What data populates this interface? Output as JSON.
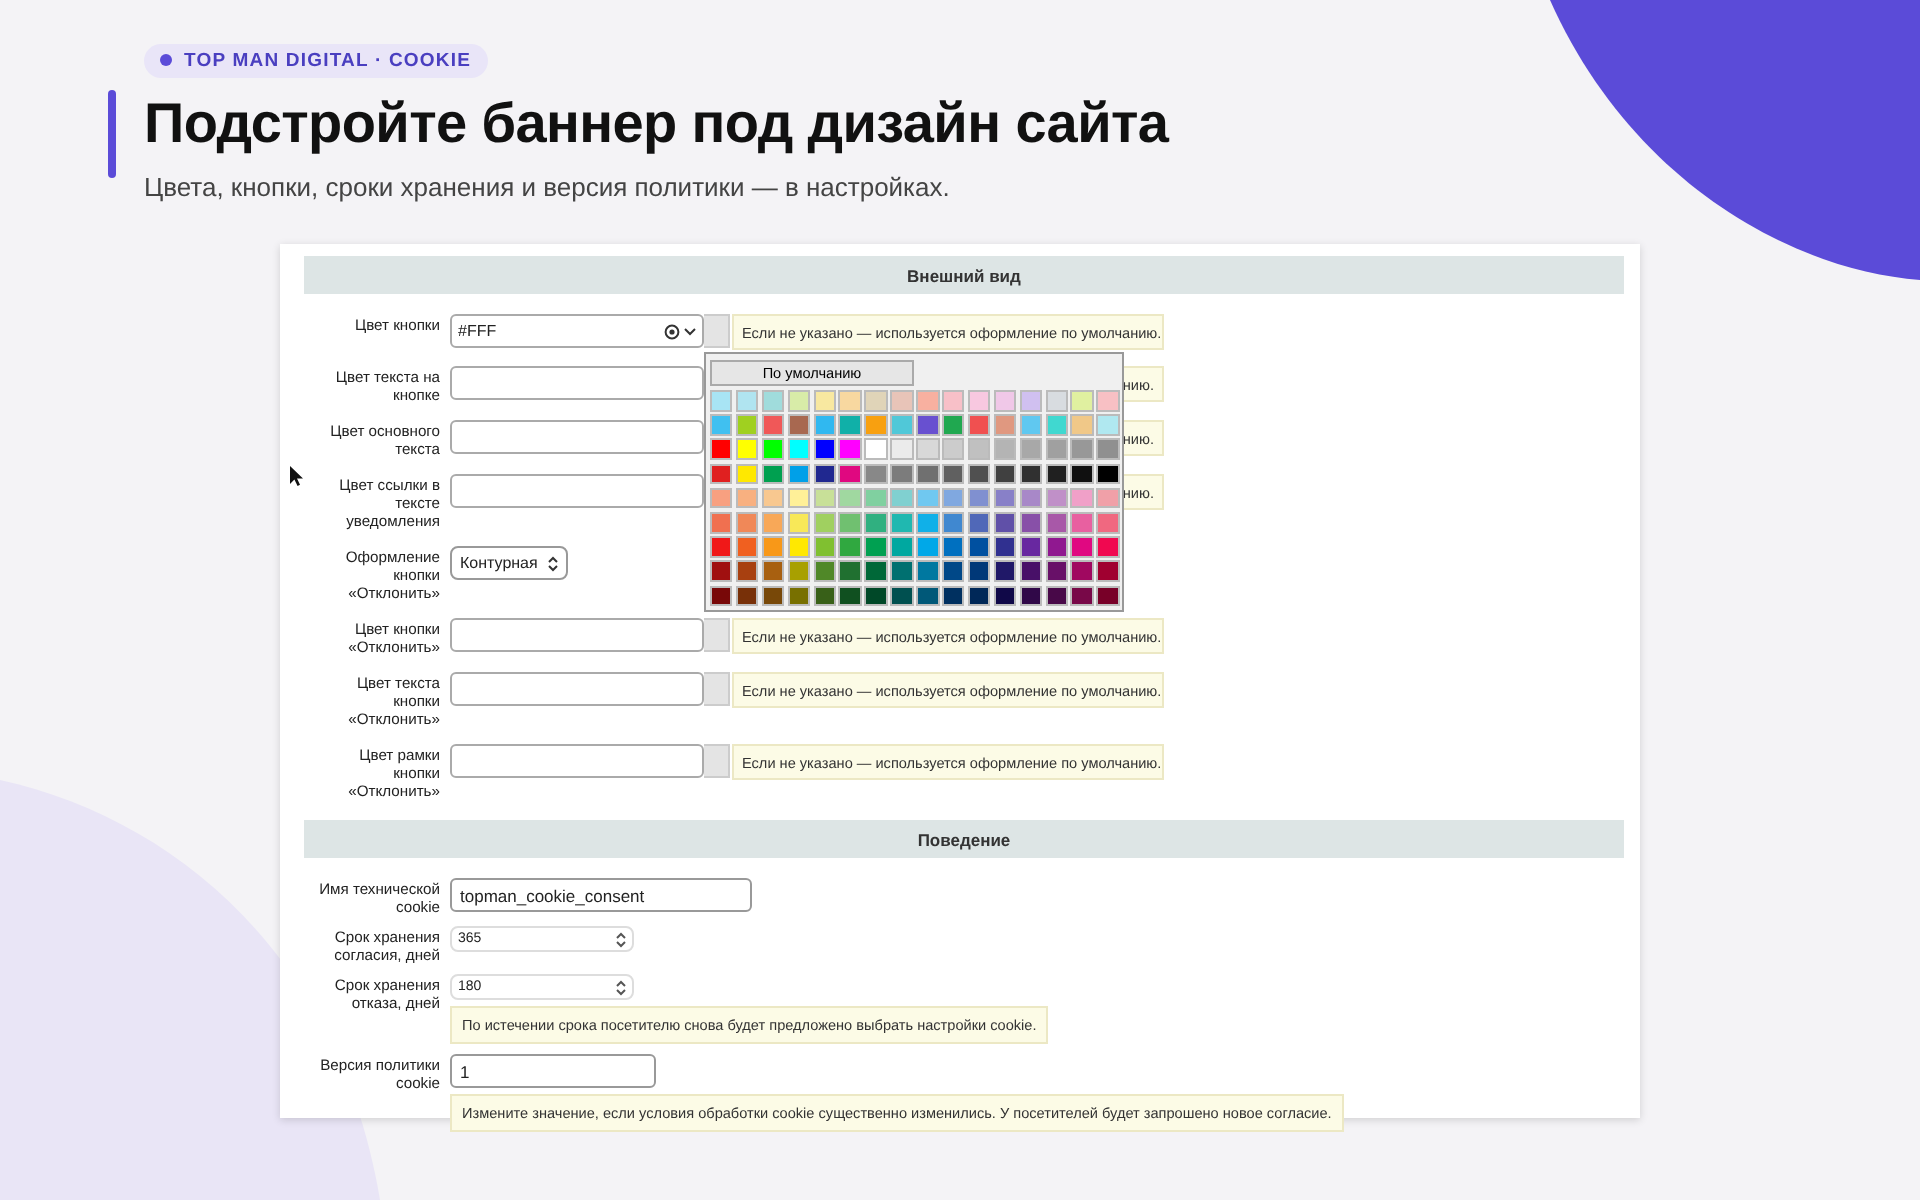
{
  "badge": "TOP MAN DIGITAL · COOKIE",
  "title": "Подстройте баннер под дизайн сайта",
  "subtitle": "Цвета, кнопки, сроки хранения и версия политики — в настройках.",
  "appearance": {
    "heading": "Внешний вид",
    "rows": [
      {
        "kind": "color",
        "label": "Цвет кнопки",
        "value": "#FFF",
        "hint": "Если не указано — используется оформление по умолчанию.",
        "hint_partial": false,
        "color_picker": {
          "default_button": "По умолчанию",
          "palette": [
            [
              {
                "color": "#a8e4f4"
              },
              {
                "color": "#b0e4f0"
              },
              {
                "color": "#a0dcdc"
              },
              {
                "color": "#d8eca8"
              },
              {
                "color": "#f8e8a0"
              },
              {
                "color": "#f8d8a0"
              },
              {
                "color": "#e0d4b8"
              },
              {
                "color": "#e8c4b8"
              },
              {
                "color": "#f8b0a0"
              },
              {
                "color": "#f8c0c8"
              },
              {
                "color": "#f8c8e0"
              },
              {
                "color": "#f0c8e8"
              },
              {
                "color": "#d0c0f0"
              },
              {
                "color": "#d8dce0"
              },
              {
                "color": "#e0f0a0"
              },
              {
                "color": "#f8c0c4"
              }
            ],
            [
              {
                "color": "#40c0f0"
              },
              {
                "color": "#a0d020"
              },
              {
                "color": "#f05858"
              },
              {
                "color": "#a86850"
              },
              {
                "color": "#30b8f0"
              },
              {
                "color": "#10b0a8"
              },
              {
                "color": "#f8a010"
              },
              {
                "color": "#50c8d8"
              },
              {
                "color": "#6850d0"
              },
              {
                "color": "#20a850"
              },
              {
                "color": "#f05050"
              },
              {
                "color": "#e09880"
              },
              {
                "color": "#60c8f0"
              },
              {
                "color": "#40d8d0"
              },
              {
                "color": "#f0c888"
              },
              {
                "color": "#b0e8f0"
              }
            ],
            [
              {
                "color": "#ff0000"
              },
              {
                "color": "#ffff00"
              },
              {
                "color": "#00ff00"
              },
              {
                "color": "#00ffff"
              },
              {
                "color": "#0000ff"
              },
              {
                "color": "#ff00ff"
              },
              {
                "color": "#ffffff"
              },
              {
                "color": "#ebebeb"
              },
              {
                "color": "#d8d8d8"
              },
              {
                "color": "#cccccc"
              },
              {
                "color": "#c0c0c0"
              },
              {
                "color": "#b4b4b4"
              },
              {
                "color": "#a8a8a8"
              },
              {
                "color": "#a0a0a0"
              },
              {
                "color": "#989898"
              },
              {
                "color": "#909090"
              }
            ],
            [
              {
                "color": "#e02020"
              },
              {
                "color": "#ffe800"
              },
              {
                "color": "#00a050"
              },
              {
                "color": "#00a0e8"
              },
              {
                "color": "#202890"
              },
              {
                "color": "#e00880"
              },
              {
                "color": "#888888"
              },
              {
                "color": "#7c7c7c"
              },
              {
                "color": "#707070"
              },
              {
                "color": "#606060"
              },
              {
                "color": "#505050"
              },
              {
                "color": "#404040"
              },
              {
                "color": "#303030"
              },
              {
                "color": "#202020"
              },
              {
                "color": "#101010"
              },
              {
                "color": "#000000"
              }
            ],
            [
              {
                "color": "#f8a080"
              },
              {
                "color": "#f8b080"
              },
              {
                "color": "#f8c890"
              },
              {
                "color": "#fff098"
              },
              {
                "color": "#c8e098"
              },
              {
                "color": "#a0d8a0"
              },
              {
                "color": "#80d0a0"
              },
              {
                "color": "#80d0d0"
              },
              {
                "color": "#70c8f0"
              },
              {
                "color": "#80a8e0"
              },
              {
                "color": "#8090d0"
              },
              {
                "color": "#8880c8"
              },
              {
                "color": "#a888c8"
              },
              {
                "color": "#c090c8"
              },
              {
                "color": "#f0a0c8"
              },
              {
                "color": "#f0a0a8"
              }
            ],
            [
              {
                "color": "#f07050"
              },
              {
                "color": "#f08858"
              },
              {
                "color": "#f8a858"
              },
              {
                "color": "#f8e858"
              },
              {
                "color": "#a0d060"
              },
              {
                "color": "#70c070"
              },
              {
                "color": "#30b080"
              },
              {
                "color": "#20b8b0"
              },
              {
                "color": "#10b0e8"
              },
              {
                "color": "#4088d0"
              },
              {
                "color": "#5068b8"
              },
              {
                "color": "#6050a8"
              },
              {
                "color": "#8850a8"
              },
              {
                "color": "#a858a8"
              },
              {
                "color": "#e860a0"
              },
              {
                "color": "#f06880"
              }
            ],
            [
              {
                "color": "#f01818"
              },
              {
                "color": "#f06020"
              },
              {
                "color": "#f89818"
              },
              {
                "color": "#ffe801"
              },
              {
                "color": "#80c030"
              },
              {
                "color": "#30a840"
              },
              {
                "color": "#00a051"
              },
              {
                "color": "#00a8a0"
              },
              {
                "color": "#00a8e8"
              },
              {
                "color": "#0070c0"
              },
              {
                "color": "#0050a0"
              },
              {
                "color": "#303090"
              },
              {
                "color": "#6828a0"
              },
              {
                "color": "#901890"
              },
              {
                "color": "#e00881"
              },
              {
                "color": "#f00850"
              }
            ],
            [
              {
                "color": "#a01010"
              },
              {
                "color": "#a84010"
              },
              {
                "color": "#a86010"
              },
              {
                "color": "#a8a000"
              },
              {
                "color": "#508828"
              },
              {
                "color": "#207030"
              },
              {
                "color": "#006838"
              },
              {
                "color": "#007070"
              },
              {
                "color": "#0078a0"
              },
              {
                "color": "#004888"
              },
              {
                "color": "#003878"
              },
              {
                "color": "#201868"
              },
              {
                "color": "#481068"
              },
              {
                "color": "#681068"
              },
              {
                "color": "#a00860"
              },
              {
                "color": "#a00030"
              }
            ],
            [
              {
                "color": "#780808"
              },
              {
                "color": "#783008"
              },
              {
                "color": "#784808"
              },
              {
                "color": "#787000"
              },
              {
                "color": "#386018"
              },
              {
                "color": "#105020"
              },
              {
                "color": "#004828"
              },
              {
                "color": "#005050"
              },
              {
                "color": "#005878"
              },
              {
                "color": "#003060"
              },
              {
                "color": "#002858"
              },
              {
                "color": "#100848"
              },
              {
                "color": "#300848"
              },
              {
                "color": "#480848"
              },
              {
                "color": "#780848"
              },
              {
                "color": "#780028"
              }
            ]
          ]
        }
      },
      {
        "kind": "color",
        "label": "Цвет текста на кнопке",
        "value": "",
        "hint": "нию.",
        "hint_partial": true
      },
      {
        "kind": "color",
        "label": "Цвет основного текста",
        "value": "",
        "hint": "нию.",
        "hint_partial": true
      },
      {
        "kind": "color",
        "label": "Цвет ссылки в тексте уведомления",
        "value": "",
        "hint": "нию.",
        "hint_partial": true
      },
      {
        "kind": "select",
        "label": "Оформление кнопки «Отклонить»",
        "value": "Контурная"
      },
      {
        "kind": "color",
        "label": "Цвет кнопки «Отклонить»",
        "value": "",
        "hint": "Если не указано — используется оформление по умолчанию.",
        "hint_partial": false
      },
      {
        "kind": "color",
        "label": "Цвет текста кнопки «Отклонить»",
        "value": "",
        "hint": "Если не указано — используется оформление по умолчанию.",
        "hint_partial": false
      },
      {
        "kind": "color",
        "label": "Цвет рамки кнопки «Отклонить»",
        "value": "",
        "hint": "Если не указано — используется оформление по умолчанию.",
        "hint_partial": false
      }
    ]
  },
  "behavior": {
    "heading": "Поведение",
    "rows": [
      {
        "kind": "text",
        "label": "Имя технической cookie",
        "value": "topman_cookie_consent"
      },
      {
        "kind": "number",
        "label": "Срок хранения согласия, дней",
        "value": "365"
      },
      {
        "kind": "number",
        "label": "Срок хранения отказа, дней",
        "value": "180",
        "hint": "По истечении срока посетителю снова будет предложено выбрать настройки cookie."
      },
      {
        "kind": "short_text",
        "label": "Версия политики cookie",
        "value": "1",
        "hint": "Измените значение, если условия обработки cookie существенно изменились. У посетителей будет запрошено новое согласие."
      }
    ]
  }
}
